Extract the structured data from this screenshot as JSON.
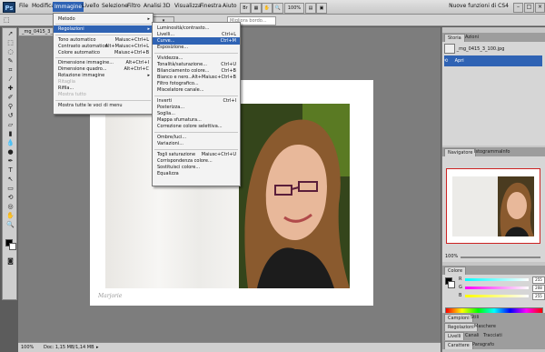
{
  "app": {
    "logo": "Ps"
  },
  "menubar": {
    "items": [
      "File",
      "Modifica",
      "Immagine",
      "Livello",
      "Selezione",
      "Filtro",
      "Analisi",
      "3D",
      "Visualizza",
      "Finestra",
      "Aiuto"
    ],
    "zoom": "100%",
    "workspace": "Nuove funzioni di CS4"
  },
  "options": {
    "field_placeholder": "Migliora bordo..."
  },
  "document": {
    "tab": "_mg_0415_3_...",
    "signature": "Marjorie"
  },
  "status": {
    "zoom": "100%",
    "doc": "Doc: 1,15 MB/1,14 MB"
  },
  "menu_immagine": {
    "items": [
      {
        "label": "Metodo",
        "submenu": true
      },
      {
        "label": "Regolazioni",
        "submenu": true,
        "selected": true
      },
      {
        "label": "Tono automatico",
        "shortcut": "Maiusc+Ctrl+L"
      },
      {
        "label": "Contrasto automatico",
        "shortcut": "Alt+Maiusc+Ctrl+L"
      },
      {
        "label": "Colore automatico",
        "shortcut": "Maiusc+Ctrl+B"
      },
      {
        "label": "Dimensione immagine...",
        "shortcut": "Alt+Ctrl+I"
      },
      {
        "label": "Dimensione quadro...",
        "shortcut": "Alt+Ctrl+C"
      },
      {
        "label": "Rotazione immagine",
        "submenu": true
      },
      {
        "label": "Ritaglia",
        "disabled": true
      },
      {
        "label": "Rifila..."
      },
      {
        "label": "Mostra tutto",
        "disabled": true
      },
      {
        "label": "Mostra tutte le voci di menu"
      }
    ]
  },
  "menu_regolazioni": {
    "items": [
      {
        "label": "Luminosità/contrasto..."
      },
      {
        "label": "Livelli...",
        "shortcut": "Ctrl+L"
      },
      {
        "label": "Curve...",
        "shortcut": "Ctrl+M",
        "selected": true
      },
      {
        "label": "Esposizione..."
      },
      {
        "label": "Vividezza..."
      },
      {
        "label": "Tonalità/saturazione...",
        "shortcut": "Ctrl+U"
      },
      {
        "label": "Bilanciamento colore...",
        "shortcut": "Ctrl+B"
      },
      {
        "label": "Bianco e nero...",
        "shortcut": "Alt+Maiusc+Ctrl+B"
      },
      {
        "label": "Filtro fotografico..."
      },
      {
        "label": "Miscelatore canale..."
      },
      {
        "label": "Inverti",
        "shortcut": "Ctrl+I"
      },
      {
        "label": "Posterizza..."
      },
      {
        "label": "Soglia..."
      },
      {
        "label": "Mappa sfumatura..."
      },
      {
        "label": "Correzione colore selettiva..."
      },
      {
        "label": "Ombre/luci..."
      },
      {
        "label": "Variazioni..."
      },
      {
        "label": "Togli saturazione",
        "shortcut": "Maiusc+Ctrl+U"
      },
      {
        "label": "Corrispondenza colore..."
      },
      {
        "label": "Sostituisci colore..."
      },
      {
        "label": "Equalizza"
      }
    ]
  },
  "panels": {
    "history": {
      "tabs": [
        "Storia",
        "Azioni"
      ],
      "rows": [
        "_mg_0415_3_100.jpg",
        "Apri"
      ]
    },
    "navigator": {
      "tabs": [
        "Navigatore",
        "Istogramma",
        "Info"
      ],
      "zoom": "100%"
    },
    "color": {
      "tabs": [
        "Colore"
      ],
      "r": "255",
      "g": "208",
      "b": "255"
    },
    "bottom_tabs": [
      [
        "Campioni",
        "Stili"
      ],
      [
        "Regolazioni",
        "Maschere"
      ],
      [
        "Livelli",
        "Canali",
        "Tracciati"
      ],
      [
        "Carattere",
        "Paragrafo"
      ]
    ]
  }
}
